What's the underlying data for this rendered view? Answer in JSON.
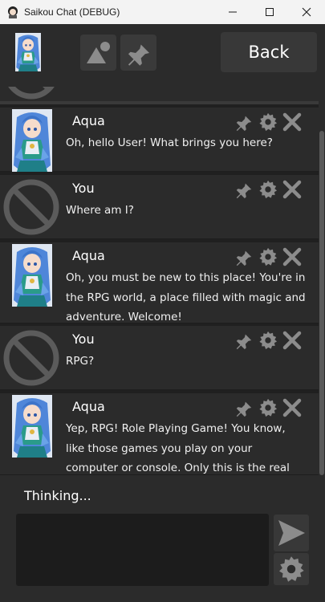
{
  "window": {
    "title": "Saikou Chat (DEBUG)",
    "controls": [
      "minimize-icon",
      "maximize-icon",
      "close-icon"
    ]
  },
  "toolbar": {
    "back_label": "Back",
    "icons": [
      "image-icon",
      "pin-icon"
    ]
  },
  "messages": [
    {
      "speaker": "Aqua",
      "text": "Oh, hello User! What brings you here?",
      "avatar": "aqua-portrait"
    },
    {
      "speaker": "You",
      "text": "Where am I?",
      "avatar": "no-avatar-icon"
    },
    {
      "speaker": "Aqua",
      "text": "Oh, you must be new to this place! You're in the RPG world, a place filled with magic and adventure. Welcome!",
      "avatar": "aqua-portrait"
    },
    {
      "speaker": "You",
      "text": "RPG?",
      "avatar": "no-avatar-icon"
    },
    {
      "speaker": "Aqua",
      "text": "Yep, RPG! Role Playing Game! You know, like those games you play on your computer or console. Only this is the real deal!",
      "avatar": "aqua-portrait"
    }
  ],
  "message_actions": [
    "pin-icon",
    "gear-icon",
    "close-icon"
  ],
  "composer": {
    "status": "Thinking...",
    "input_value": "",
    "send_icon": "send-icon",
    "settings_icon": "gear-icon"
  },
  "colors": {
    "background": "#202020",
    "panel": "#2b2b2b",
    "button": "#383838",
    "icon_gray": "#8c8c8c",
    "titlebar": "#f3f3f3"
  }
}
